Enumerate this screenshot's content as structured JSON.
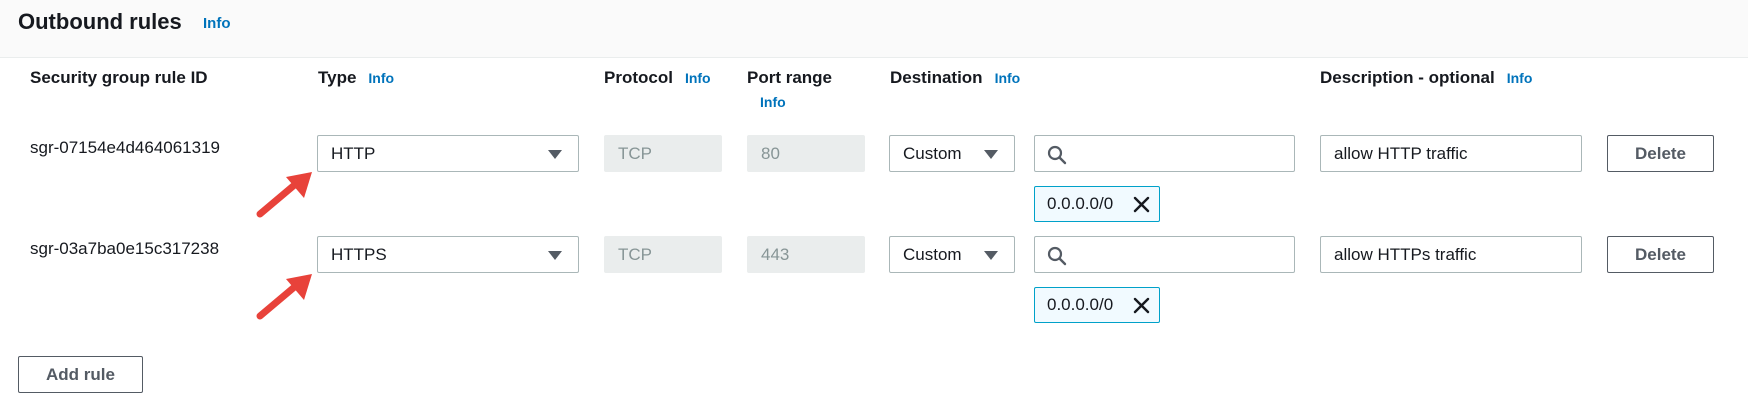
{
  "section": {
    "title": "Outbound rules",
    "info": "Info"
  },
  "columns": {
    "rule_id": "Security group rule ID",
    "type": "Type",
    "type_info": "Info",
    "protocol": "Protocol",
    "protocol_info": "Info",
    "port_range": "Port range",
    "port_range_info": "Info",
    "destination": "Destination",
    "destination_info": "Info",
    "description": "Description - optional",
    "description_info": "Info"
  },
  "rules": [
    {
      "rule_id": "sgr-07154e4d464061319",
      "type": "HTTP",
      "protocol": "TCP",
      "port_range": "80",
      "destination_type": "Custom",
      "search_value": "",
      "cidr": "0.0.0.0/0",
      "description": "allow HTTP traffic",
      "delete_label": "Delete"
    },
    {
      "rule_id": "sgr-03a7ba0e15c317238",
      "type": "HTTPS",
      "protocol": "TCP",
      "port_range": "443",
      "destination_type": "Custom",
      "search_value": "",
      "cidr": "0.0.0.0/0",
      "description": "allow HTTPs traffic",
      "delete_label": "Delete"
    }
  ],
  "add_rule_label": "Add rule",
  "icons": {
    "search": "search-icon",
    "remove": "close-icon",
    "dropdown": "caret-down-icon",
    "annotation": "red-arrow-annotation"
  },
  "colors": {
    "link": "#0073bb",
    "token_border": "#00a1c9",
    "annotation_arrow": "#e8423a"
  }
}
